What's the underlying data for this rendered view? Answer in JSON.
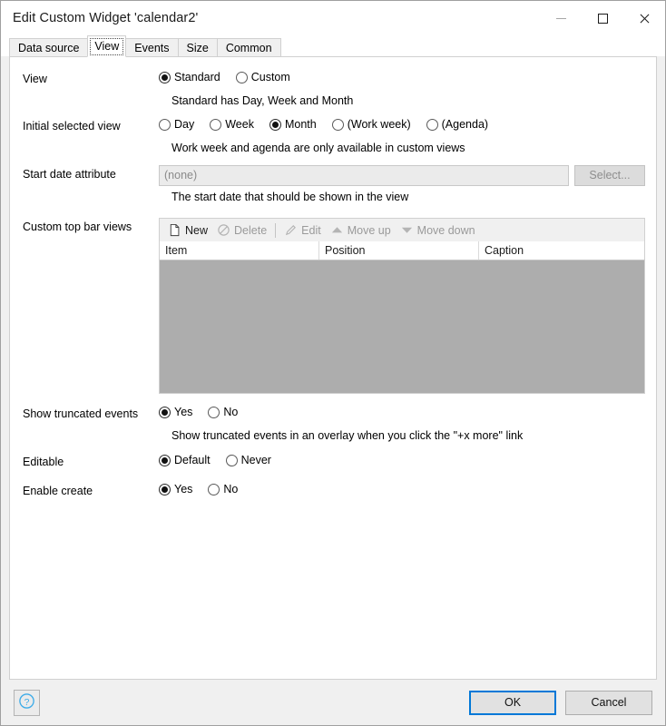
{
  "window": {
    "title": "Edit Custom Widget 'calendar2'",
    "controls": {
      "minimize": "—",
      "maximize": "□",
      "close": "✕"
    }
  },
  "tabs": [
    {
      "label": "Data source",
      "selected": false
    },
    {
      "label": "View",
      "selected": true
    },
    {
      "label": "Events",
      "selected": false
    },
    {
      "label": "Size",
      "selected": false
    },
    {
      "label": "Common",
      "selected": false
    }
  ],
  "form": {
    "view": {
      "label": "View",
      "options": [
        {
          "label": "Standard",
          "checked": true
        },
        {
          "label": "Custom",
          "checked": false
        }
      ],
      "hint": "Standard has Day, Week and Month"
    },
    "initial_selected_view": {
      "label": "Initial selected view",
      "options": [
        {
          "label": "Day",
          "checked": false
        },
        {
          "label": "Week",
          "checked": false
        },
        {
          "label": "Month",
          "checked": true
        },
        {
          "label": "(Work week)",
          "checked": false
        },
        {
          "label": "(Agenda)",
          "checked": false
        }
      ],
      "hint": "Work week and agenda are only available in custom views"
    },
    "start_date_attribute": {
      "label": "Start date attribute",
      "value": "(none)",
      "select_button": "Select...",
      "hint": "The start date that should be shown in the view"
    },
    "custom_top_bar_views": {
      "label": "Custom top bar views",
      "toolbar": [
        {
          "label": "New",
          "icon": "new-page-icon",
          "enabled": true
        },
        {
          "label": "Delete",
          "icon": "delete-prohibit-icon",
          "enabled": false
        },
        {
          "label": "Edit",
          "icon": "edit-pencil-icon",
          "enabled": false
        },
        {
          "label": "Move up",
          "icon": "move-up-triangle-icon",
          "enabled": false
        },
        {
          "label": "Move down",
          "icon": "move-down-triangle-icon",
          "enabled": false
        }
      ],
      "columns": [
        "Item",
        "Position",
        "Caption"
      ],
      "rows": []
    },
    "show_truncated_events": {
      "label": "Show truncated events",
      "options": [
        {
          "label": "Yes",
          "checked": true
        },
        {
          "label": "No",
          "checked": false
        }
      ],
      "hint": "Show truncated events in an overlay when you click the \"+x more\" link"
    },
    "editable": {
      "label": "Editable",
      "options": [
        {
          "label": "Default",
          "checked": true
        },
        {
          "label": "Never",
          "checked": false
        }
      ]
    },
    "enable_create": {
      "label": "Enable create",
      "options": [
        {
          "label": "Yes",
          "checked": true
        },
        {
          "label": "No",
          "checked": false
        }
      ]
    }
  },
  "footer": {
    "help_icon": "help-question-icon",
    "ok_label": "OK",
    "cancel_label": "Cancel"
  },
  "colors": {
    "accent": "#0078d7",
    "help_icon": "#3cabe8",
    "window_bg": "#f0f0f0",
    "disabled_list": "#adadad",
    "disabled_text": "#8e8e8e"
  }
}
